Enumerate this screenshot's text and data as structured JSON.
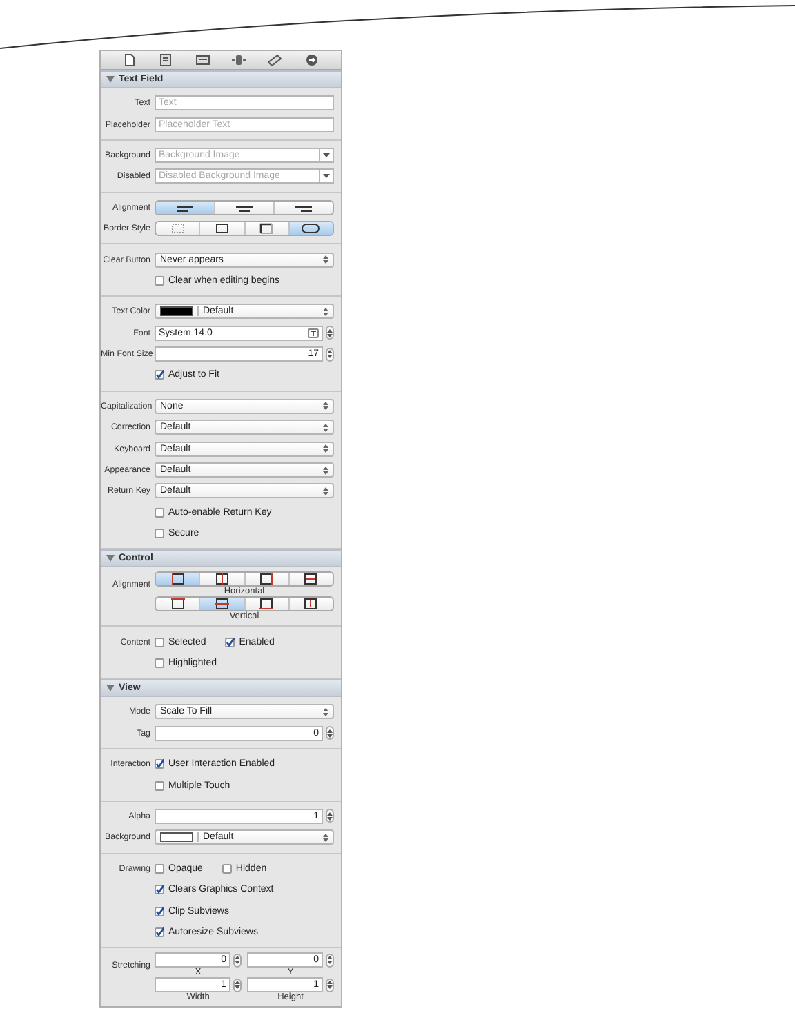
{
  "sections": [
    {
      "title": "Text Field",
      "expanded": true,
      "groups": [
        {
          "rows": [
            {
              "kind": "field",
              "label": "Text",
              "placeholder": "Text"
            },
            {
              "kind": "field",
              "label": "Placeholder",
              "placeholder": "Placeholder Text"
            }
          ]
        },
        {
          "rows": [
            {
              "kind": "combo",
              "label": "Background",
              "placeholder": "Background Image"
            },
            {
              "kind": "combo",
              "label": "Disabled",
              "placeholder": "Disabled Background Image"
            }
          ]
        },
        {
          "rows": [
            {
              "kind": "segmented",
              "label": "Alignment",
              "segments": [
                {
                  "kind": "align-left",
                  "selected": true
                },
                {
                  "kind": "align-center",
                  "selected": false
                },
                {
                  "kind": "align-right",
                  "selected": false
                }
              ]
            },
            {
              "kind": "segmented",
              "label": "Border Style",
              "segments": [
                {
                  "kind": "border-none",
                  "selected": false
                },
                {
                  "kind": "border-line",
                  "selected": false
                },
                {
                  "kind": "border-bezel",
                  "selected": false
                },
                {
                  "kind": "border-rounded",
                  "selected": true
                }
              ]
            }
          ]
        },
        {
          "rows": [
            {
              "kind": "select",
              "label": "Clear Button",
              "value": "Never appears"
            },
            {
              "kind": "checks",
              "items": [
                {
                  "label": "Clear when editing begins",
                  "checked": false
                }
              ]
            }
          ]
        },
        {
          "rows": [
            {
              "kind": "color",
              "label": "Text Color",
              "value": "Default",
              "color": "#000000"
            },
            {
              "kind": "font",
              "label": "Font",
              "value": "System 14.0"
            },
            {
              "kind": "stepper",
              "label": "Min Font Size",
              "value": "17"
            },
            {
              "kind": "checks",
              "items": [
                {
                  "label": "Adjust to Fit",
                  "checked": true
                }
              ]
            }
          ]
        },
        {
          "rows": [
            {
              "kind": "select",
              "label": "Capitalization",
              "value": "None"
            },
            {
              "kind": "select",
              "label": "Correction",
              "value": "Default"
            },
            {
              "kind": "select",
              "label": "Keyboard",
              "value": "Default"
            },
            {
              "kind": "select",
              "label": "Appearance",
              "value": "Default"
            },
            {
              "kind": "select",
              "label": "Return Key",
              "value": "Default"
            },
            {
              "kind": "checks",
              "items": [
                {
                  "label": "Auto-enable Return Key",
                  "checked": false
                }
              ]
            },
            {
              "kind": "checks",
              "items": [
                {
                  "label": "Secure",
                  "checked": false
                }
              ]
            }
          ]
        }
      ]
    },
    {
      "title": "Control",
      "expanded": true,
      "groups": [
        {
          "rows": [
            {
              "kind": "segmented",
              "label": "Alignment",
              "caption": "Horizontal",
              "segments": [
                {
                  "kind": "h-left",
                  "selected": true
                },
                {
                  "kind": "h-center",
                  "selected": false
                },
                {
                  "kind": "h-right",
                  "selected": false
                },
                {
                  "kind": "h-fill",
                  "selected": false
                }
              ]
            },
            {
              "kind": "segmented",
              "caption": "Vertical",
              "segments": [
                {
                  "kind": "v-top",
                  "selected": false
                },
                {
                  "kind": "v-center",
                  "selected": true
                },
                {
                  "kind": "v-bottom",
                  "selected": false
                },
                {
                  "kind": "v-fill",
                  "selected": false
                }
              ]
            }
          ]
        },
        {
          "rows": [
            {
              "kind": "checks",
              "label": "Content",
              "items": [
                {
                  "label": "Selected",
                  "checked": false
                },
                {
                  "label": "Enabled",
                  "checked": true
                }
              ]
            },
            {
              "kind": "checks",
              "items": [
                {
                  "label": "Highlighted",
                  "checked": false
                }
              ]
            }
          ]
        }
      ]
    },
    {
      "title": "View",
      "expanded": true,
      "groups": [
        {
          "rows": [
            {
              "kind": "select",
              "label": "Mode",
              "value": "Scale To Fill"
            },
            {
              "kind": "stepper",
              "label": "Tag",
              "value": "0"
            }
          ]
        },
        {
          "rows": [
            {
              "kind": "checks",
              "label": "Interaction",
              "items": [
                {
                  "label": "User Interaction Enabled",
                  "checked": true
                }
              ]
            },
            {
              "kind": "checks",
              "items": [
                {
                  "label": "Multiple Touch",
                  "checked": false
                }
              ]
            }
          ]
        },
        {
          "rows": [
            {
              "kind": "stepper",
              "label": "Alpha",
              "value": "1"
            },
            {
              "kind": "color",
              "label": "Background",
              "value": "Default",
              "color": "#ffffff"
            }
          ]
        },
        {
          "rows": [
            {
              "kind": "checks",
              "label": "Drawing",
              "items": [
                {
                  "label": "Opaque",
                  "checked": false
                },
                {
                  "label": "Hidden",
                  "checked": false
                }
              ]
            },
            {
              "kind": "checks",
              "items": [
                {
                  "label": "Clears Graphics Context",
                  "checked": true
                }
              ]
            },
            {
              "kind": "checks",
              "items": [
                {
                  "label": "Clip Subviews",
                  "checked": true
                }
              ]
            },
            {
              "kind": "checks",
              "items": [
                {
                  "label": "Autoresize Subviews",
                  "checked": true
                }
              ]
            }
          ]
        },
        {
          "rows": [
            {
              "kind": "stretch",
              "label": "Stretching",
              "fields": [
                {
                  "value": "0",
                  "caption": "X"
                },
                {
                  "value": "0",
                  "caption": "Y"
                }
              ]
            },
            {
              "kind": "stretch",
              "fields": [
                {
                  "value": "1",
                  "caption": "Width"
                },
                {
                  "value": "1",
                  "caption": "Height"
                }
              ]
            }
          ]
        }
      ]
    }
  ]
}
